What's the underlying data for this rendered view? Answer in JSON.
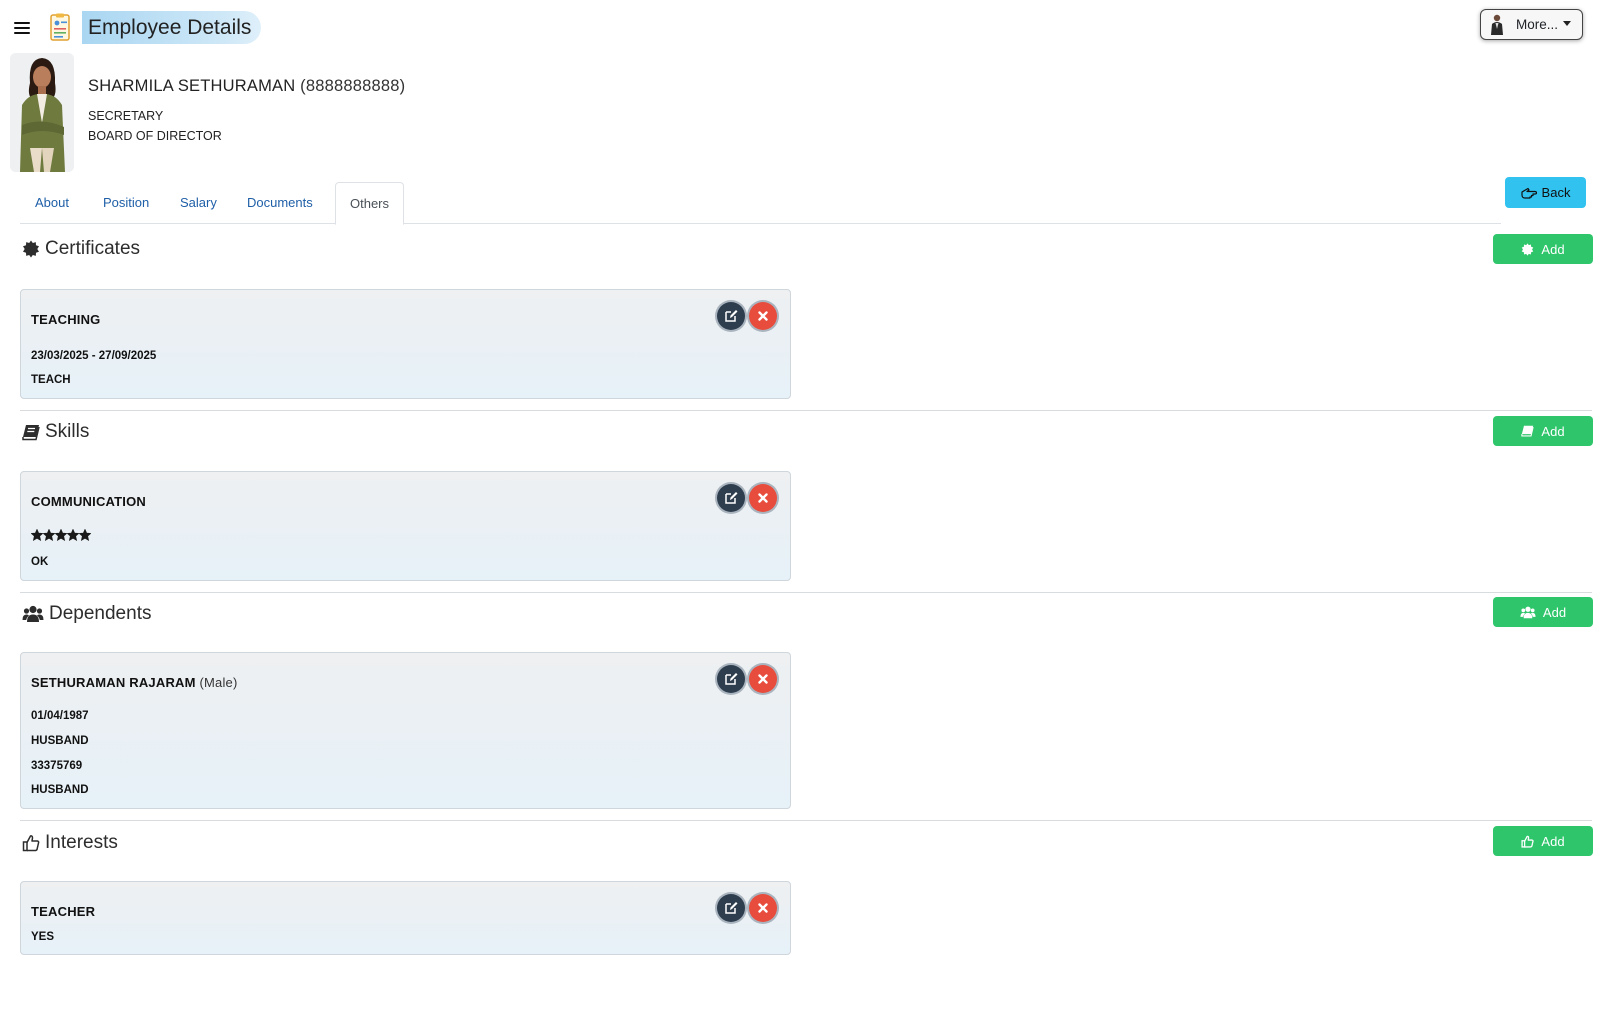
{
  "header": {
    "title": "Employee Details",
    "more_label": "More..."
  },
  "employee": {
    "name": "SHARMILA SETHURAMAN",
    "phone": "(8888888888)",
    "designation": "SECRETARY",
    "department": "BOARD OF DIRECTOR"
  },
  "tabs": [
    {
      "label": "About"
    },
    {
      "label": "Position"
    },
    {
      "label": "Salary"
    },
    {
      "label": "Documents"
    },
    {
      "label": "Others",
      "active": true
    }
  ],
  "back_label": "Back",
  "add_label": "Add",
  "colors": {
    "add_green": "#2ec56b",
    "back_blue": "#31c2f0",
    "delete_red": "#e74c3c",
    "edit_dark": "#2f3e4e",
    "link_blue": "#1f5fa8"
  },
  "sections": {
    "certificates": {
      "title": "Certificates",
      "icon": "certificate-icon",
      "item": {
        "name": "TEACHING",
        "period": "23/03/2025 - 27/09/2025",
        "note": "TEACH"
      }
    },
    "skills": {
      "title": "Skills",
      "icon": "book-icon",
      "item": {
        "name": "COMMUNICATION",
        "rating": 5,
        "rating_max": 5,
        "note": "OK"
      }
    },
    "dependents": {
      "title": "Dependents",
      "icon": "users-icon",
      "item": {
        "name": "SETHURAMAN RAJARAM",
        "gender": "(Male)",
        "dob": "01/04/1987",
        "relation": "HUSBAND",
        "id_number": "33375769",
        "note": "HUSBAND"
      }
    },
    "interests": {
      "title": "Interests",
      "icon": "thumbs-up-icon",
      "item": {
        "name": "TEACHER",
        "note": "YES"
      }
    }
  }
}
